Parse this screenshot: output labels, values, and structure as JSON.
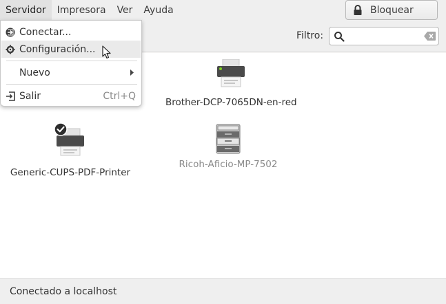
{
  "menubar": {
    "items": [
      {
        "label": "Servidor"
      },
      {
        "label": "Impresora"
      },
      {
        "label": "Ver"
      },
      {
        "label": "Ayuda"
      }
    ]
  },
  "toolbar": {
    "lock_label": "Bloquear",
    "filter_label": "Filtro:",
    "filter_value": ""
  },
  "server_menu": {
    "connect": "Conectar...",
    "settings": "Configuración...",
    "new": "Nuevo",
    "quit": "Salir",
    "quit_shortcut": "Ctrl+Q"
  },
  "printers": [
    {
      "name": "Brother-DCP-7065DN-en-red",
      "enabled": true,
      "default": false
    },
    {
      "name": "Generic-CUPS-PDF-Printer",
      "enabled": true,
      "default": true
    },
    {
      "name": "Ricoh-Aficio-MP-7502",
      "enabled": false,
      "default": false
    }
  ],
  "status": {
    "text": "Conectado a localhost"
  },
  "icons": {
    "lock": "lock-icon",
    "search": "search-icon",
    "clear": "clear-icon",
    "connect": "connect-icon",
    "settings": "gear-icon",
    "quit": "exit-icon",
    "submenu": "chevron-right-icon",
    "printer": "printer-icon",
    "default_check": "check-icon"
  }
}
